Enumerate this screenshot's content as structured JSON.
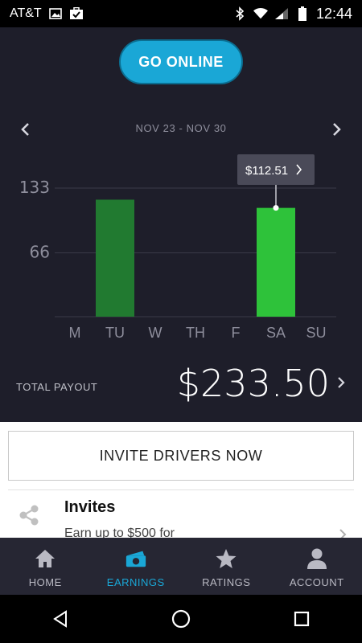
{
  "status_bar": {
    "carrier": "AT&T",
    "time": "12:44"
  },
  "header": {
    "go_online_label": "GO ONLINE"
  },
  "week": {
    "label": "NOV 23 - NOV 30"
  },
  "chart_data": {
    "type": "bar",
    "categories": [
      "M",
      "TU",
      "W",
      "TH",
      "F",
      "SA",
      "SU"
    ],
    "values": [
      0,
      121,
      0,
      0,
      0,
      112.51,
      0
    ],
    "ylim": [
      0,
      133
    ],
    "yticks": [
      66,
      133
    ],
    "highlighted_index": 5,
    "tooltip": "$112.51",
    "colors": {
      "highlight": "#2ec23a",
      "normal": "#217a30",
      "grid": "#3a3a48"
    }
  },
  "total": {
    "label": "TOTAL PAYOUT",
    "value": "$233.50"
  },
  "panel": {
    "invite_button_label": "INVITE DRIVERS NOW",
    "invites_title": "Invites",
    "invites_subtitle": "Earn up to $500 for"
  },
  "tabs": [
    {
      "label": "HOME",
      "icon": "home-icon"
    },
    {
      "label": "EARNINGS",
      "icon": "earnings-icon"
    },
    {
      "label": "RATINGS",
      "icon": "star-icon"
    },
    {
      "label": "ACCOUNT",
      "icon": "account-icon"
    }
  ],
  "colors": {
    "accent": "#1aa7d6",
    "background": "#1e1e2a"
  }
}
